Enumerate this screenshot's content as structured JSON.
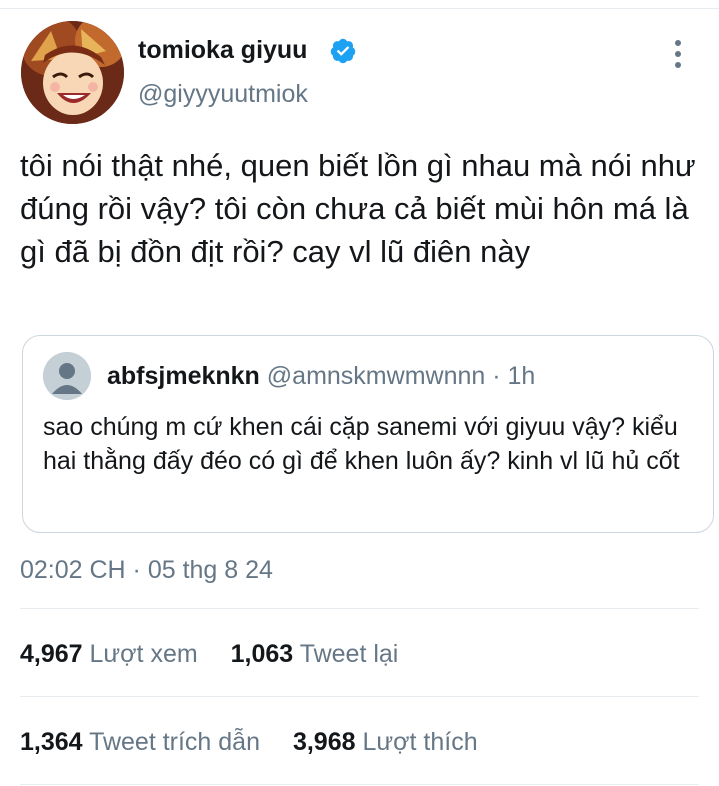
{
  "author": {
    "name": "tomioka giyuu",
    "handle": "@giyyyuutmiok",
    "avatar_icon": "anime-avatar",
    "verified_icon": "verified-badge-icon"
  },
  "tweet": {
    "text": "tôi nói thật nhé, quen biết lồn gì nhau mà nói như đúng rồi vậy? tôi còn chưa cả biết mùi hôn má là gì đã bị đồn địt rồi? cay vl lũ điên này",
    "timestamp": "02:02 CH · 05 thg 8 24"
  },
  "quoted_tweet": {
    "name": "abfsjmeknkn",
    "handle": "@amnskmwmwnnn",
    "time": "· 1h",
    "text": "sao chúng m cứ khen cái cặp sanemi với giyuu vậy? kiểu hai thằng đấy đéo có gì để khen luôn ấy? kinh vl lũ hủ cốt"
  },
  "stats": {
    "views": {
      "value": "4,967",
      "label": "Lượt xem"
    },
    "retweets": {
      "value": "1,063",
      "label": "Tweet lại"
    },
    "quotes": {
      "value": "1,364",
      "label": "Tweet trích dẫn"
    },
    "likes": {
      "value": "3,968",
      "label": "Lượt thích"
    }
  },
  "colors": {
    "accent": "#1da1f2",
    "secondary_text": "#657786",
    "border": "#ccd6dd"
  }
}
